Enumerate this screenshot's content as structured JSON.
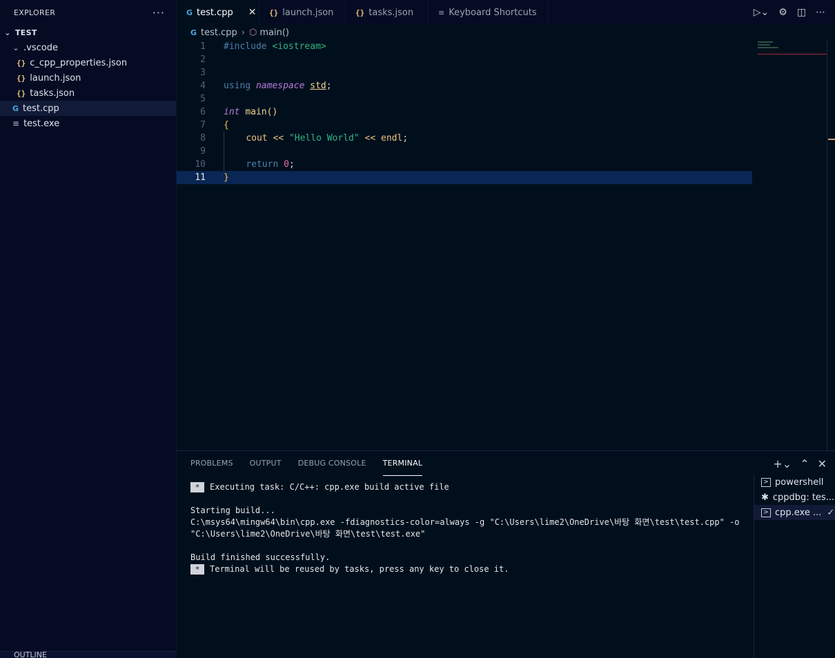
{
  "sidebar": {
    "title": "EXPLORER",
    "more_label": "···",
    "section": "TEST",
    "folder": ".vscode",
    "files_nested": [
      "c_cpp_properties.json",
      "launch.json",
      "tasks.json"
    ],
    "file_cpp": "test.cpp",
    "file_exe": "test.exe",
    "outline": "OUTLINE"
  },
  "tabs": [
    {
      "label": "test.cpp",
      "active": true
    },
    {
      "label": "launch.json"
    },
    {
      "label": "tasks.json"
    },
    {
      "label": "Keyboard Shortcuts"
    }
  ],
  "breadcrumb": {
    "file": "test.cpp",
    "symbol": "main()"
  },
  "editor": {
    "line_numbers": [
      "1",
      "2",
      "3",
      "4",
      "5",
      "6",
      "7",
      "8",
      "9",
      "10",
      "11"
    ],
    "include_directive": "#include",
    "include_target": "<iostream>",
    "using_kw": "using",
    "namespace_kw": "namespace",
    "std_id": "std",
    "semicolon": ";",
    "int_kw": "int",
    "main_fn": "main()",
    "open_brace": "{",
    "cout": "cout",
    "shift_op": "<<",
    "hello_str": "\"Hello World\"",
    "endl": "endl",
    "return_kw": "return",
    "zero": "0",
    "close_brace": "}"
  },
  "panel": {
    "tabs": [
      "PROBLEMS",
      "OUTPUT",
      "DEBUG CONSOLE",
      "TERMINAL"
    ],
    "active_tab": "TERMINAL",
    "terminal_lines": {
      "exec": "Executing task: C/C++: cpp.exe build active file",
      "starting": "Starting build...",
      "cmd1": "C:\\msys64\\mingw64\\bin\\cpp.exe -fdiagnostics-color=always -g \"C:\\Users\\lime2\\OneDrive\\바탕 화면\\test\\test.cpp\" -o",
      "cmd2": "\"C:\\Users\\lime2\\OneDrive\\바탕 화면\\test\\test.exe\"",
      "finished": "Build finished successfully.",
      "reuse": "Terminal will be reused by tasks, press any key to close it."
    },
    "star": "*",
    "terminal_sessions": [
      "powershell",
      "cppdbg: tes...",
      "cpp.exe ..."
    ]
  }
}
